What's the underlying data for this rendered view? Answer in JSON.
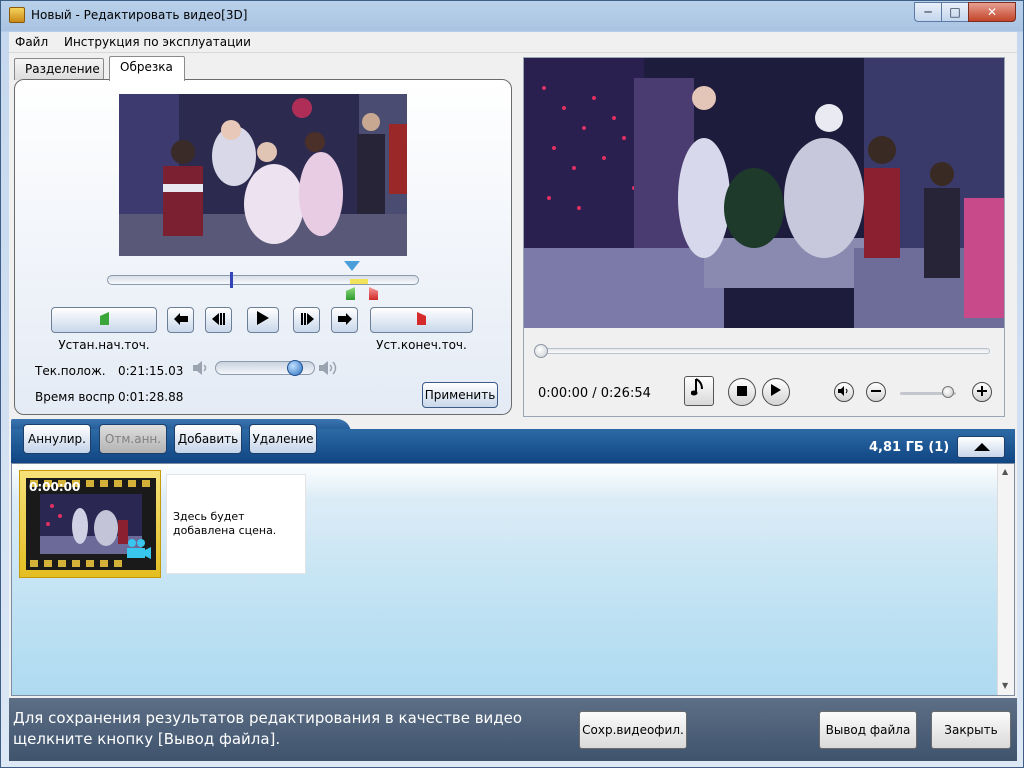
{
  "window": {
    "title": "Новый - Редактировать видео[3D]",
    "min_label": "─",
    "max_label": "□",
    "close_label": "✕"
  },
  "menu": {
    "items": [
      "Файл",
      "Инструкция по эксплуатации"
    ]
  },
  "tabs": {
    "split": "Разделение",
    "trim": "Обрезка"
  },
  "trim": {
    "set_start_label": "Устан.нач.точ.",
    "set_end_label": "Уст.конеч.точ.",
    "current_pos_label": "Тек.полож.",
    "current_pos_value": "0:21:15.03",
    "play_time_label": "Время воспр",
    "play_time_value": "0:01:28.88",
    "apply_label": "Применить",
    "volume_level": 0.8
  },
  "player": {
    "time": "0:00:00 / 0:26:54",
    "seek_position": 0.0
  },
  "toolbar": {
    "cancel_label": "Аннулир.",
    "undo_label": "Отм.анн.",
    "add_label": "Добавить",
    "delete_label": "Удаление",
    "size_label": "4,81 ГБ (1)"
  },
  "timeline": {
    "clip_time": "0:00:00",
    "placeholder_text": "Здесь будет добавлена сцена."
  },
  "footer": {
    "hint": "Для сохранения результатов редактирования в качестве видео щелкните кнопку [Вывод файла].",
    "save_video_label": "Сохр.видеофил.",
    "output_label": "Вывод файла",
    "close_label": "Закрыть"
  },
  "colors": {
    "accent_blue": "#1d5592",
    "footer_bg": "#4a5d77",
    "timeline_bg": "#c0e2f3"
  }
}
